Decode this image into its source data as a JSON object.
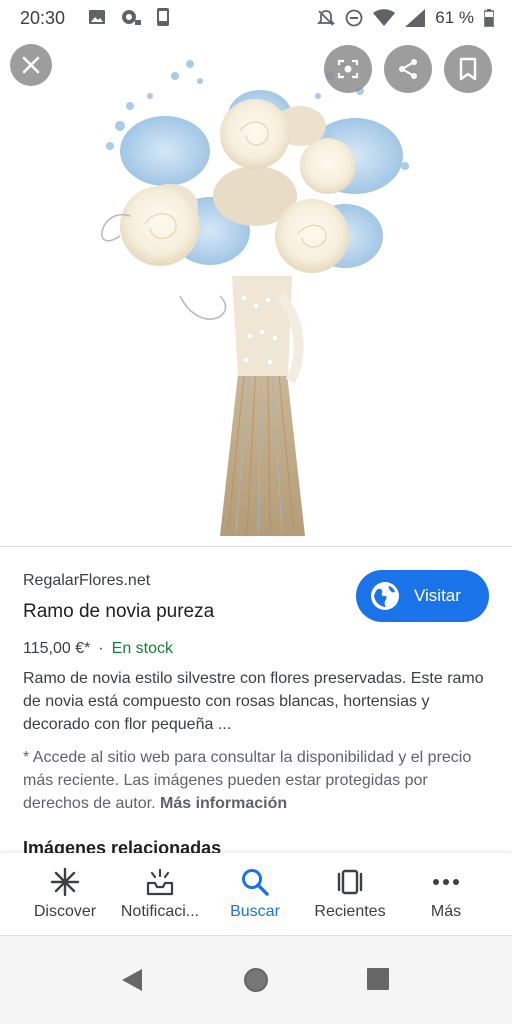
{
  "status_bar": {
    "time": "20:30",
    "battery": "61 %",
    "icons": [
      "image-icon",
      "cast-icon",
      "phone-icon",
      "mute-icon",
      "dnd-icon",
      "wifi-icon",
      "signal-icon",
      "battery-icon"
    ]
  },
  "viewer": {
    "image_subject": "bridal bouquet",
    "buttons": [
      "close-icon",
      "lens-icon",
      "share-icon",
      "bookmark-icon"
    ]
  },
  "result": {
    "source": "RegalarFlores.net",
    "title": "Ramo de novia pureza",
    "visit_label": "Visitar",
    "price": "115,00 €*",
    "separator": "·",
    "stock": "En stock",
    "description": "Ramo de novia estilo silvestre con flores preservadas. Este ramo de novia está compuesto con rosas blancas, hortensias y decorado con flor pequeña ...",
    "notice": "* Accede al sitio web para consultar la disponibilidad y el precio más reciente. Las imágenes pueden estar protegidas por derechos de autor.",
    "more_info": "Más información",
    "related_heading": "Imágenes relacionadas"
  },
  "bottom_nav": {
    "items": [
      {
        "label": "Discover",
        "icon": "discover-icon"
      },
      {
        "label": "Notificaci...",
        "icon": "notifications-icon"
      },
      {
        "label": "Buscar",
        "icon": "search-icon"
      },
      {
        "label": "Recientes",
        "icon": "recents-icon"
      },
      {
        "label": "Más",
        "icon": "more-icon"
      }
    ],
    "active_index": 2
  },
  "colors": {
    "accent": "#1a73e8",
    "stock_green": "#188038",
    "text_primary": "#202124",
    "text_secondary": "#3c4043"
  }
}
